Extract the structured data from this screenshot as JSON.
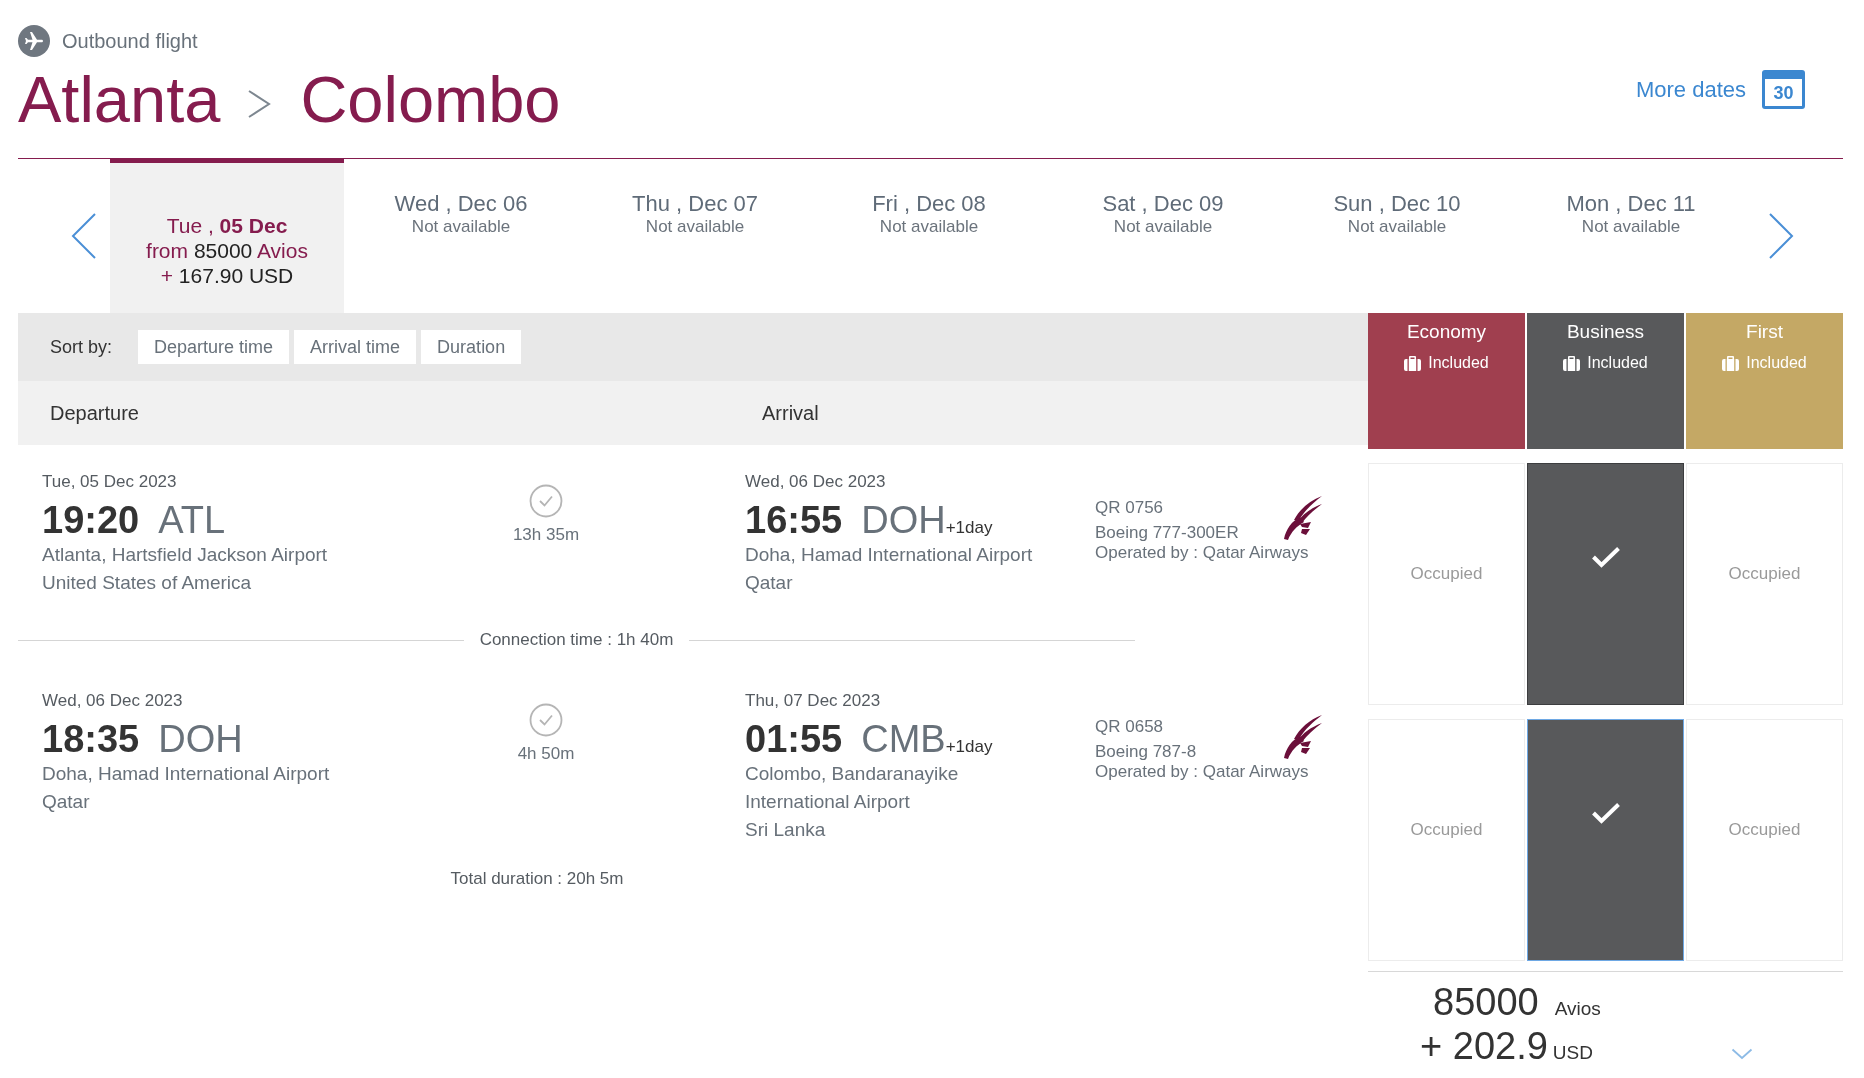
{
  "header": {
    "subtitle": "Outbound flight",
    "origin": "Atlanta",
    "destination": "Colombo"
  },
  "more_dates": {
    "label": "More dates",
    "calendar_day": "30"
  },
  "date_strip": {
    "tabs": [
      {
        "date": "Tue , **05 Dec**",
        "fare": "from **85000** Avios",
        "taxes": "+ **167.90 USD**",
        "selected": true
      },
      {
        "date": "Wed , Dec 06",
        "status": "Not available",
        "selected": false
      },
      {
        "date": "Thu , Dec 07",
        "status": "Not available",
        "selected": false
      },
      {
        "date": "Fri , Dec 08",
        "status": "Not available",
        "selected": false
      },
      {
        "date": "Sat , Dec 09",
        "status": "Not available",
        "selected": false
      },
      {
        "date": "Sun , Dec 10",
        "status": "Not available",
        "selected": false
      },
      {
        "date": "Mon , Dec 11",
        "status": "Not available",
        "selected": false
      }
    ]
  },
  "sort_bar": {
    "label": "Sort by:",
    "options": [
      "Departure time",
      "Arrival time",
      "Duration"
    ]
  },
  "columns": [
    "Departure",
    "Arrival"
  ],
  "cabins": [
    {
      "name": "Economy",
      "baggage": "Included",
      "color": "#a03f4f"
    },
    {
      "name": "Business",
      "baggage": "Included",
      "color": "#58595b"
    },
    {
      "name": "First",
      "baggage": "Included",
      "color": "#c4a865"
    }
  ],
  "segments": [
    {
      "departure": {
        "date": "Tue, 05 Dec 2023",
        "time": "19:20",
        "code": "ATL",
        "airport": "Atlanta, Hartsfield Jackson Airport",
        "country": "United States of America"
      },
      "duration": "13h 35m",
      "arrival": {
        "date": "Wed, 06 Dec 2023",
        "time": "16:55",
        "code": "DOH",
        "day_offset": "+1day",
        "airport": "Doha, Hamad International Airport",
        "country": "Qatar"
      },
      "flight_number": "QR 0756",
      "aircraft": "Boeing 777-300ER",
      "operator": "Operated by : Qatar Airways",
      "fares": [
        {
          "kind": "occupied",
          "label": "Occupied"
        },
        {
          "kind": "available",
          "checked": true,
          "highlighted": false
        },
        {
          "kind": "occupied",
          "label": "Occupied"
        }
      ]
    },
    {
      "departure": {
        "date": "Wed, 06 Dec 2023",
        "time": "18:35",
        "code": "DOH",
        "airport": "Doha, Hamad International Airport",
        "country": "Qatar"
      },
      "duration": "4h 50m",
      "arrival": {
        "date": "Thu, 07 Dec 2023",
        "time": "01:55",
        "code": "CMB",
        "day_offset": "+1day",
        "airport": "Colombo, Bandaranayike International Airport",
        "country": "Sri Lanka"
      },
      "flight_number": "QR 0658",
      "aircraft": "Boeing 787-8",
      "operator": "Operated by : Qatar Airways",
      "fares": [
        {
          "kind": "occupied",
          "label": "Occupied"
        },
        {
          "kind": "available",
          "checked": true,
          "highlighted": true
        },
        {
          "kind": "occupied",
          "label": "Occupied"
        }
      ]
    }
  ],
  "connection": "Connection time : 1h 40m",
  "total_duration": "Total duration : 20h 5m",
  "price": {
    "avios": "85000",
    "avios_unit": "Avios",
    "cash": "+ 202.9",
    "currency": "USD"
  }
}
